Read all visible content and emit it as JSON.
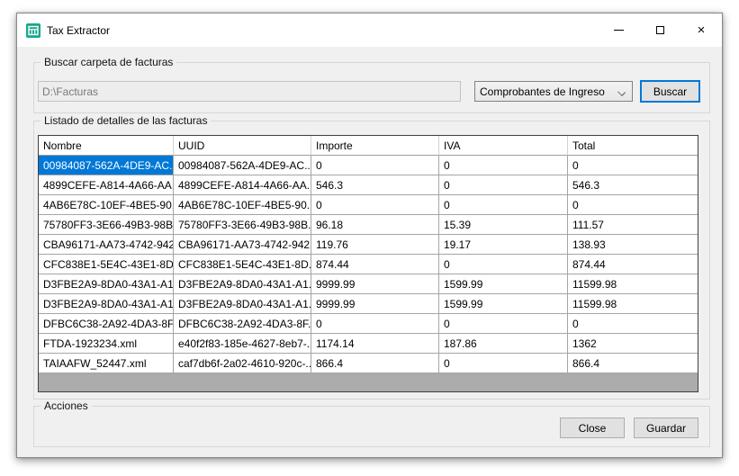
{
  "window": {
    "title": "Tax Extractor",
    "close_glyph": "×"
  },
  "search_section": {
    "label": "Buscar carpeta de facturas",
    "folder_input_value": "D:\\Facturas",
    "type_dropdown_value": "Comprobantes de Ingreso",
    "search_button_label": "Buscar"
  },
  "list_section": {
    "label": "Listado de detalles de las facturas",
    "table": {
      "columns": [
        "Nombre",
        "UUID",
        "Importe",
        "IVA",
        "Total"
      ],
      "rows": [
        [
          "00984087-562A-4DE9-AC...",
          "00984087-562A-4DE9-AC...",
          "0",
          "0",
          "0"
        ],
        [
          "4899CEFE-A814-4A66-AA...",
          "4899CEFE-A814-4A66-AA...",
          "546.3",
          "0",
          "546.3"
        ],
        [
          "4AB6E78C-10EF-4BE5-90...",
          "4AB6E78C-10EF-4BE5-90...",
          "0",
          "0",
          "0"
        ],
        [
          "75780FF3-3E66-49B3-98B...",
          "75780FF3-3E66-49B3-98B...",
          "96.18",
          "15.39",
          "111.57"
        ],
        [
          "CBA96171-AA73-4742-942...",
          "CBA96171-AA73-4742-942...",
          "119.76",
          "19.17",
          "138.93"
        ],
        [
          "CFC838E1-5E4C-43E1-8D...",
          "CFC838E1-5E4C-43E1-8D...",
          "874.44",
          "0",
          "874.44"
        ],
        [
          "D3FBE2A9-8DA0-43A1-A1...",
          "D3FBE2A9-8DA0-43A1-A1...",
          "9999.99",
          "1599.99",
          "11599.98"
        ],
        [
          "D3FBE2A9-8DA0-43A1-A1...",
          "D3FBE2A9-8DA0-43A1-A1...",
          "9999.99",
          "1599.99",
          "11599.98"
        ],
        [
          "DFBC6C38-2A92-4DA3-8F...",
          "DFBC6C38-2A92-4DA3-8F...",
          "0",
          "0",
          "0"
        ],
        [
          "FTDA-1923234.xml",
          "e40f2f83-185e-4627-8eb7-...",
          "1174.14",
          "187.86",
          "1362"
        ],
        [
          "TAIAAFW_52447.xml",
          "caf7db6f-2a02-4610-920c-...",
          "866.4",
          "0",
          "866.4"
        ]
      ],
      "selected": {
        "row": 0,
        "col": 0
      }
    }
  },
  "actions_section": {
    "label": "Acciones",
    "close_button_label": "Close",
    "save_button_label": "Guardar"
  },
  "colors": {
    "selection_blue": "#0078D7",
    "icon_teal": "#17A78C",
    "window_bg": "#F0F0F0",
    "grid_filler": "#ACACAC"
  }
}
